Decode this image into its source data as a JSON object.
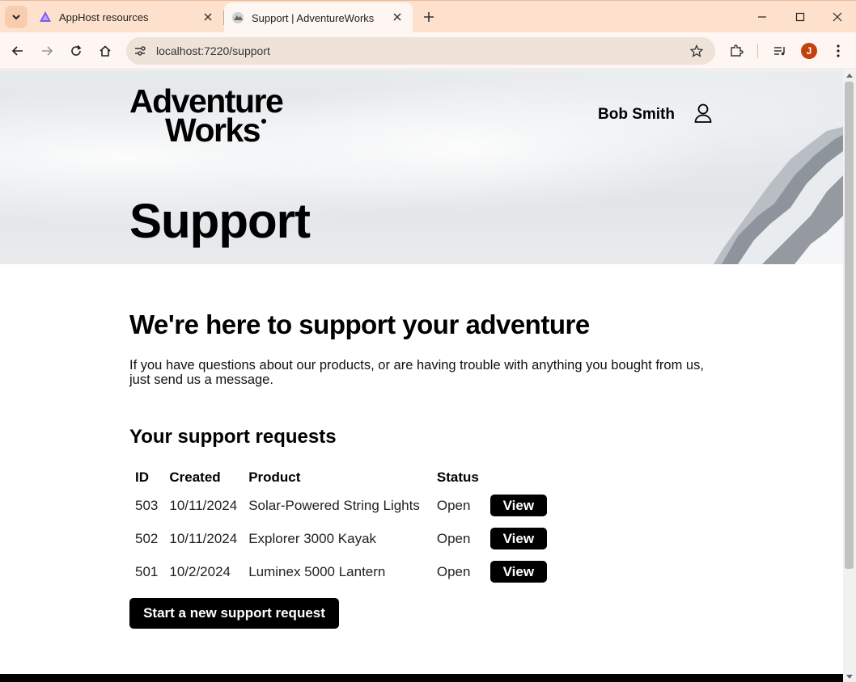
{
  "browser": {
    "tabs": [
      {
        "title": "AppHost resources",
        "active": false
      },
      {
        "title": "Support | AdventureWorks",
        "active": true
      }
    ],
    "url": "localhost:7220/support",
    "profile_initial": "J",
    "accent_color": "#fde1cc"
  },
  "header": {
    "logo_line1": "Adventure",
    "logo_line2": "Works",
    "user_name": "Bob Smith"
  },
  "hero": {
    "title": "Support"
  },
  "main": {
    "heading": "We're here to support your adventure",
    "intro": "If you have questions about our products, or are having trouble with anything you bought from us, just send us a message.",
    "requests_heading": "Your support requests",
    "columns": [
      "ID",
      "Created",
      "Product",
      "Status"
    ],
    "rows": [
      {
        "id": "503",
        "created": "10/11/2024",
        "product": "Solar-Powered String Lights",
        "status": "Open",
        "action": "View"
      },
      {
        "id": "502",
        "created": "10/11/2024",
        "product": "Explorer 3000 Kayak",
        "status": "Open",
        "action": "View"
      },
      {
        "id": "501",
        "created": "10/2/2024",
        "product": "Luminex 5000 Lantern",
        "status": "Open",
        "action": "View"
      }
    ],
    "new_request_label": "Start a new support request"
  }
}
